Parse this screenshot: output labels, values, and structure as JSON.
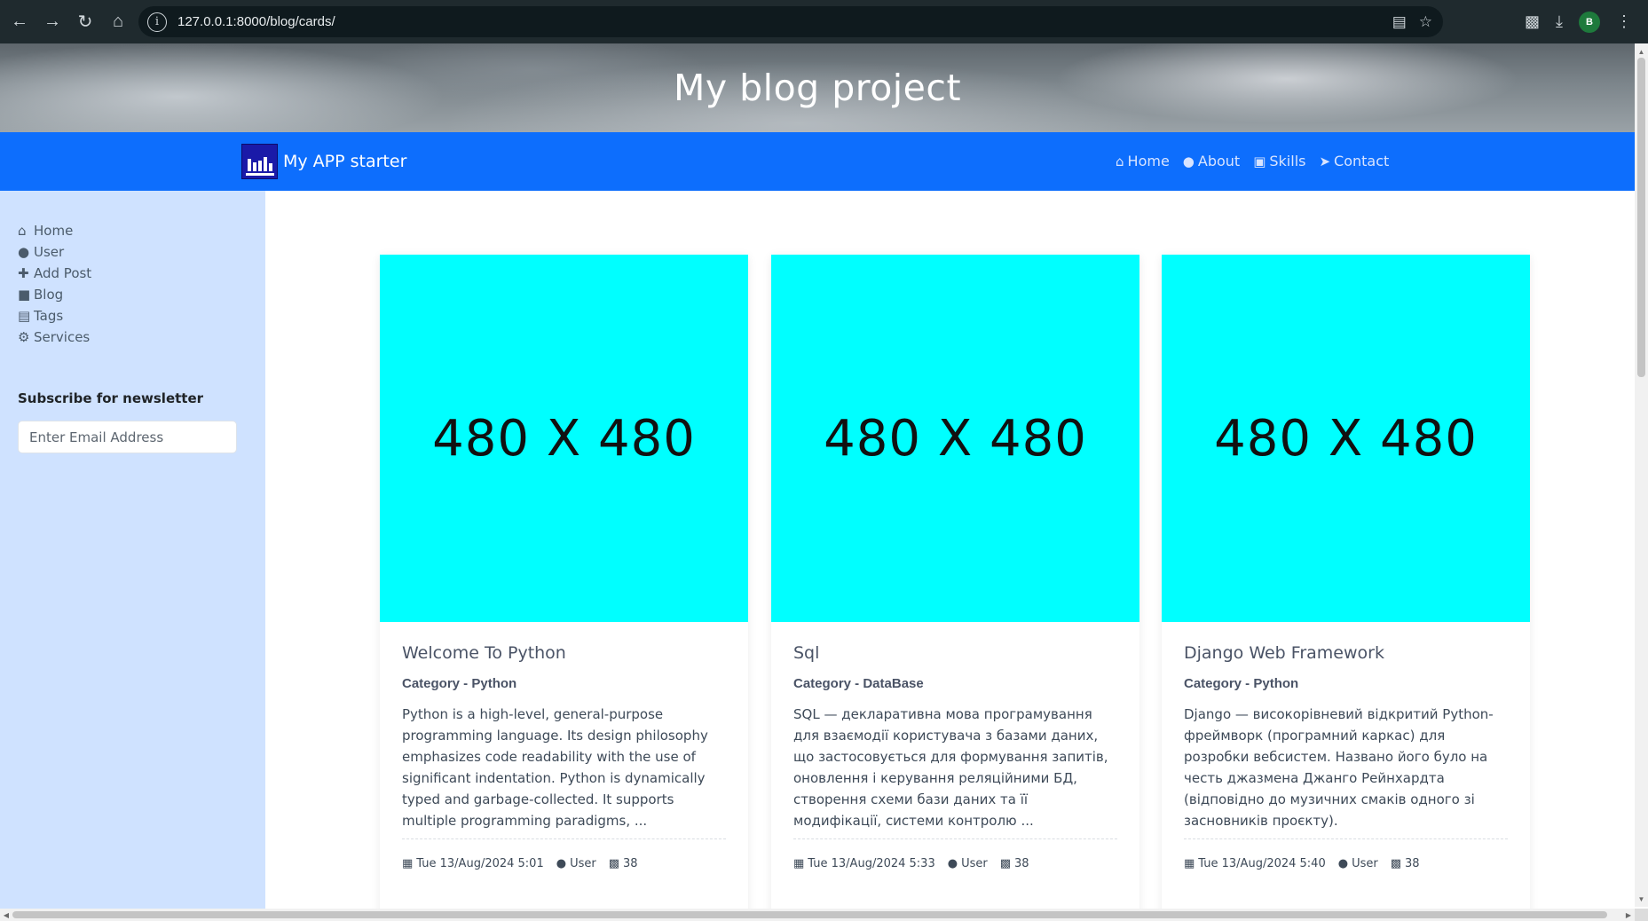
{
  "browser": {
    "url": "127.0.0.1:8000/blog/cards/",
    "profile_initial": "B"
  },
  "hero": {
    "title": "My blog project"
  },
  "navbar": {
    "brand": "My APP starter",
    "links": [
      {
        "label": "Home",
        "icon": "home-icon"
      },
      {
        "label": "About",
        "icon": "user-icon"
      },
      {
        "label": "Skills",
        "icon": "book-icon"
      },
      {
        "label": "Contact",
        "icon": "paper-plane-icon"
      }
    ]
  },
  "sidebar": {
    "items": [
      {
        "label": "Home",
        "icon": "home-icon"
      },
      {
        "label": "User",
        "icon": "user-icon"
      },
      {
        "label": "Add Post",
        "icon": "plus-icon"
      },
      {
        "label": "Blog",
        "icon": "note-icon"
      },
      {
        "label": "Tags",
        "icon": "tags-icon"
      },
      {
        "label": "Services",
        "icon": "gears-icon"
      }
    ],
    "newsletter": {
      "title": "Subscribe for newsletter",
      "placeholder": "Enter Email Address"
    }
  },
  "cards": [
    {
      "image_text": "480 X 480",
      "title": "Welcome To Python",
      "category": "Category - Python",
      "text": "Python is a high-level, general-purpose programming language. Its design philosophy emphasizes code readability with the use of significant indentation. Python is dynamically typed and garbage-collected. It supports multiple programming paradigms, ...",
      "date": "Tue 13/Aug/2024 5:01",
      "author": "User",
      "comments": "38"
    },
    {
      "image_text": "480 X 480",
      "title": "Sql",
      "category": "Category - DataBase",
      "text": "SQL — декларативна мова програмування для взаємодії користувача з базами даних, що застосовується для формування запитів, оновлення і керування реляційними БД, створення схеми бази даних та її модифікації, системи контролю ...",
      "date": "Tue 13/Aug/2024 5:33",
      "author": "User",
      "comments": "38"
    },
    {
      "image_text": "480 X 480",
      "title": "Django Web Framework",
      "category": "Category - Python",
      "text": "Django — високорівневий відкритий Python-фреймворк (програмний каркас) для розробки вебсистем. Названо його було на честь джазмена Джанго Рейнхардта (відповідно до музичних смаків одного зі засновників проєкту).",
      "date": "Tue 13/Aug/2024 5:40",
      "author": "User",
      "comments": "38"
    }
  ],
  "colors": {
    "navbar": "#0d6efd",
    "sidebar": "#cfe2ff",
    "card_image": "#00ffff"
  }
}
